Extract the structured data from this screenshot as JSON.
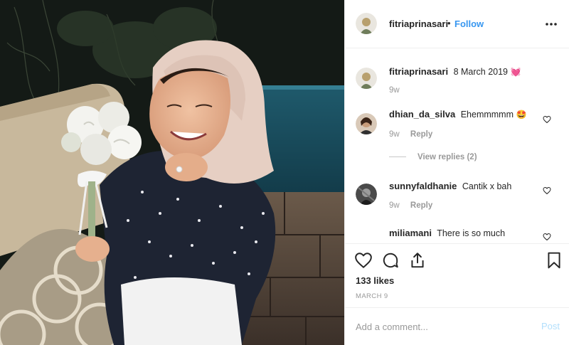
{
  "header": {
    "username": "fitriaprinasari",
    "separator": "•",
    "follow_label": "Follow",
    "more_icon": "more-horizontal-icon"
  },
  "caption": {
    "username": "fitriaprinasari",
    "text": "8 March 2019",
    "emoji": "💓",
    "time": "9w"
  },
  "comments": [
    {
      "username": "dhian_da_silva",
      "text": "Ehemmmmm",
      "emoji": "🤩",
      "time": "9w",
      "reply_label": "Reply",
      "view_replies": "View replies (2)"
    },
    {
      "username": "sunnyfaldhanie",
      "text": "Cantik x bah",
      "time": "9w",
      "reply_label": "Reply"
    },
    {
      "username": "miliamani",
      "text": "There is so much"
    }
  ],
  "actions": {
    "likes": "133 likes",
    "date": "MARCH 9",
    "icons": [
      "heart-icon",
      "comment-icon",
      "share-icon",
      "bookmark-icon"
    ]
  },
  "add_comment": {
    "placeholder": "Add a comment...",
    "post_label": "Post"
  },
  "colors": {
    "link": "#3897f0",
    "post_disabled": "#b2dffc",
    "secondary_text": "#999999"
  }
}
